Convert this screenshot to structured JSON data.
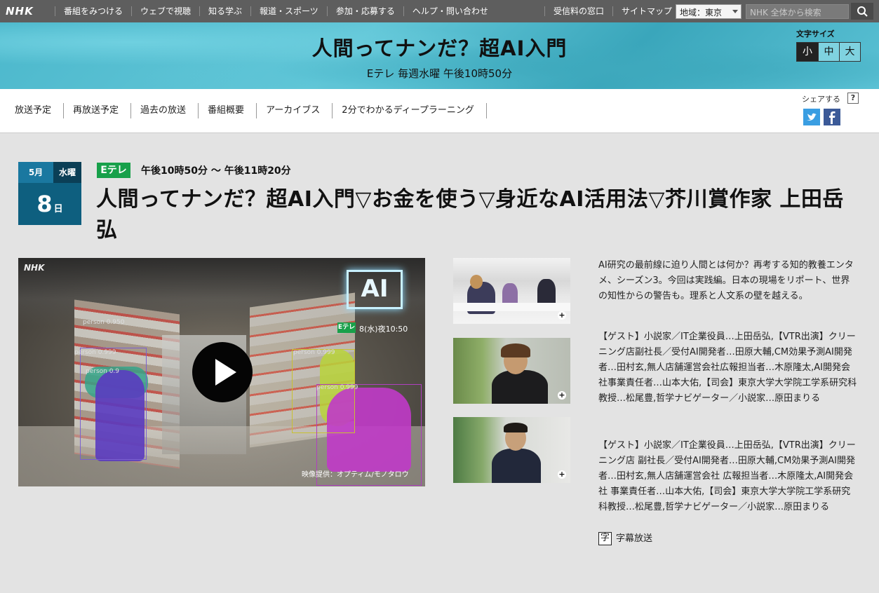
{
  "global_nav": {
    "logo": "NHK",
    "left_links": [
      "番組をみつける",
      "ウェブで視聴",
      "知る学ぶ",
      "報道・スポーツ",
      "参加・応募する",
      "ヘルプ・問い合わせ"
    ],
    "right_links": [
      "受信料の窓口",
      "サイトマップ"
    ],
    "region_select": "地域：東京",
    "search_placeholder": "NHK 全体から検索"
  },
  "banner": {
    "program_title": "人間ってナンだ？超AI入門",
    "schedule": "Eテレ 毎週水曜 午後10時50分",
    "font_size_label": "文字サイズ",
    "font_size_options": [
      "小",
      "中",
      "大"
    ]
  },
  "sub_nav": {
    "items": [
      "放送予定",
      "再放送予定",
      "過去の放送",
      "番組概要",
      "アーカイブス",
      "2分でわかるディープラーニング"
    ],
    "share_label": "シェアする",
    "help_mark": "?"
  },
  "episode": {
    "month": "5月",
    "weekday": "水曜",
    "day": "8",
    "day_suffix": "日",
    "channel": "Eテレ",
    "air_time": "午後10時50分 ～ 午後11時20分",
    "title": "人間ってナンだ？超AI入門▽お金を使う▽身近なAI活用法▽芥川賞作家 上田岳弘"
  },
  "video": {
    "overlay_logo": "NHK",
    "ai_logo": "AI",
    "overlay_channel": "Eテレ",
    "overlay_date": "8(水)夜10:50",
    "credit": "映像提供：オプティム/モノタロウ",
    "detection_labels": [
      "person 0.950",
      "person 0.999",
      "person 0.9",
      "person 0.999",
      "person 0.999"
    ]
  },
  "thumbnails": [
    {
      "plus": "+"
    },
    {
      "plus": "+"
    },
    {
      "plus": "+"
    }
  ],
  "description": {
    "intro": "AI研究の最前線に迫り人間とは何か？再考する知的教養エンタメ、シーズン3。今回は実践編。日本の現場をリポート、世界の知性からの警告も。理系と人文系の壁を越える。",
    "cast_1": "【ゲスト】小説家／IT企業役員…上田岳弘,【VTR出演】クリーニング店副社長／受付AI開発者…田原大輔,CM効果予測AI開発者…田村玄,無人店舗運営会社広報担当者…木原隆太,AI開発会社事業責任者…山本大佑,【司会】東京大学大学院工学系研究科教授…松尾豊,哲学ナビゲーター／小説家…原田まりる",
    "cast_2": "【ゲスト】小説家／IT企業役員…上田岳弘,【VTR出演】クリーニング店 副社長／受付AI開発者…田原大輔,CM効果予測AI開発者…田村玄,無人店舗運営会社 広報担当者…木原隆太,AI開発会社 事業責任者…山本大佑,【司会】東京大学大学院工学系研究科教授…松尾豊,哲学ナビゲーター／小説家…原田まりる",
    "caption_icon": "字",
    "caption_label": "字幕放送"
  }
}
